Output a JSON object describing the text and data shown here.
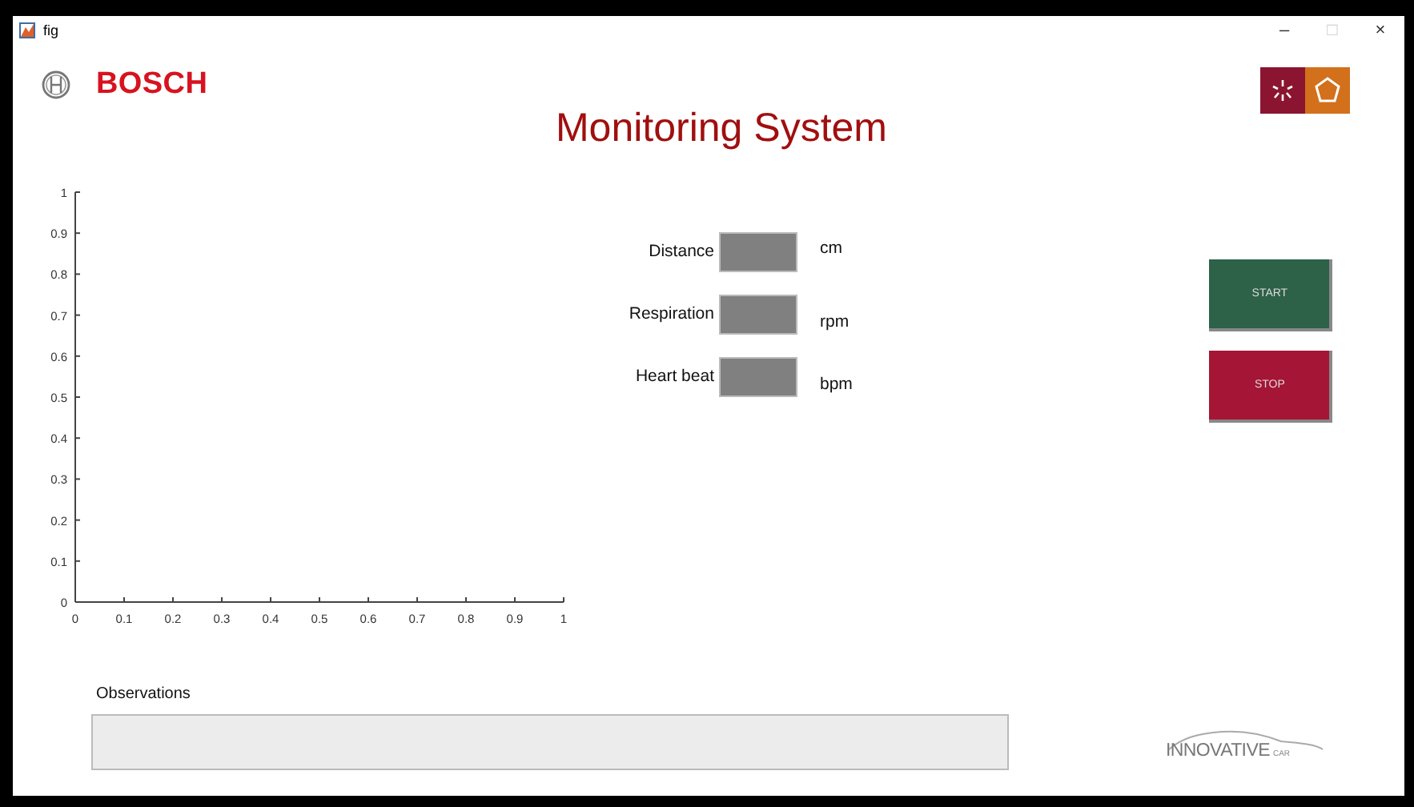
{
  "window": {
    "title": "fig",
    "controls": [
      {
        "glyph": "–",
        "disabled": false
      },
      {
        "glyph": "□",
        "disabled": true
      },
      {
        "glyph": "×",
        "disabled": false
      }
    ]
  },
  "header": {
    "brand": "BOSCH",
    "title": "Monitoring System"
  },
  "chart": {
    "chart_data": {
      "type": "line",
      "xlim": [
        0,
        1
      ],
      "ylim": [
        0,
        1
      ],
      "xticks": [
        0,
        0.1,
        0.2,
        0.3,
        0.4,
        0.5,
        0.6,
        0.7,
        0.8,
        0.9,
        1
      ],
      "yticks": [
        0,
        0.1,
        0.2,
        0.3,
        0.4,
        0.5,
        0.6,
        0.7,
        0.8,
        0.9,
        1
      ]
    }
  },
  "readings": [
    {
      "label": "Distance",
      "unit": "cm"
    },
    {
      "label": "Respiration",
      "unit": "rpm"
    },
    {
      "label": "Heart beat",
      "unit": "bpm"
    }
  ],
  "buttons": [
    {
      "label": "START",
      "kind": "start"
    },
    {
      "label": "STOP",
      "kind": "stop"
    }
  ],
  "observations": {
    "label": "Observations"
  },
  "footer_logo": {
    "name": "INNOVATIVE",
    "sub": "CAR"
  }
}
